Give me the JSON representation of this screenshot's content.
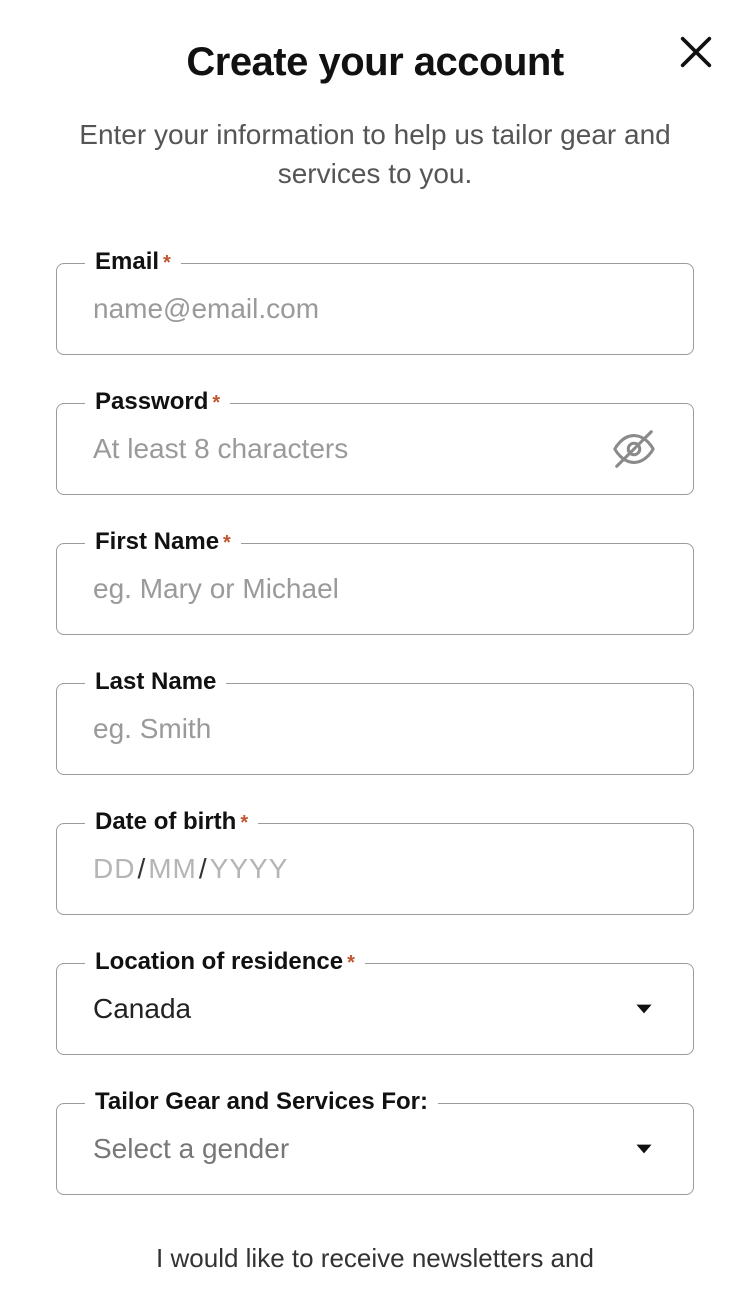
{
  "header": {
    "title": "Create your account",
    "subtitle": "Enter your information to help us tailor gear and services to you."
  },
  "fields": {
    "email": {
      "label": "Email",
      "required": true,
      "placeholder": "name@email.com",
      "value": ""
    },
    "password": {
      "label": "Password",
      "required": true,
      "placeholder": "At least 8 characters",
      "value": ""
    },
    "first_name": {
      "label": "First Name",
      "required": true,
      "placeholder": "eg. Mary or Michael",
      "value": ""
    },
    "last_name": {
      "label": "Last Name",
      "required": false,
      "placeholder": "eg. Smith",
      "value": ""
    },
    "dob": {
      "label": "Date of birth",
      "required": true,
      "segments": {
        "dd": "DD",
        "mm": "MM",
        "yyyy": "YYYY"
      },
      "value": ""
    },
    "location": {
      "label": "Location of residence",
      "required": true,
      "value": "Canada"
    },
    "gender": {
      "label": "Tailor Gear and Services For:",
      "required": false,
      "placeholder": "Select a gender",
      "value": ""
    }
  },
  "icons": {
    "close": "close-icon",
    "eye_off": "eye-off-icon",
    "chevron_down": "chevron-down-icon"
  },
  "colors": {
    "required_asterisk": "#c0562f",
    "border": "#9b9b9b",
    "placeholder": "#9a9a9a"
  },
  "newsletter_text": "I would like to receive newsletters and"
}
